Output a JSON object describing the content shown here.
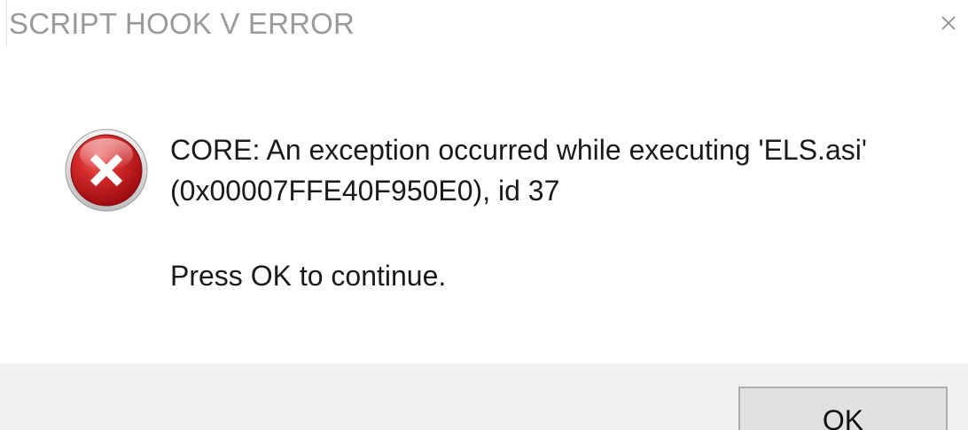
{
  "window": {
    "title": "SCRIPT HOOK V ERROR",
    "close_icon": "close-icon"
  },
  "message": {
    "icon": "error-icon",
    "line1": "CORE: An exception occurred while executing 'ELS.asi'",
    "line2": "(0x00007FFE40F950E0), id 37",
    "prompt": "Press OK to continue."
  },
  "buttons": {
    "ok_label": "OK"
  },
  "colors": {
    "title_text": "#9a9a9a",
    "footer_bg": "#f0f0f0",
    "button_bg": "#e1e1e1",
    "button_border": "#adadad",
    "error_red": "#c8181e"
  }
}
